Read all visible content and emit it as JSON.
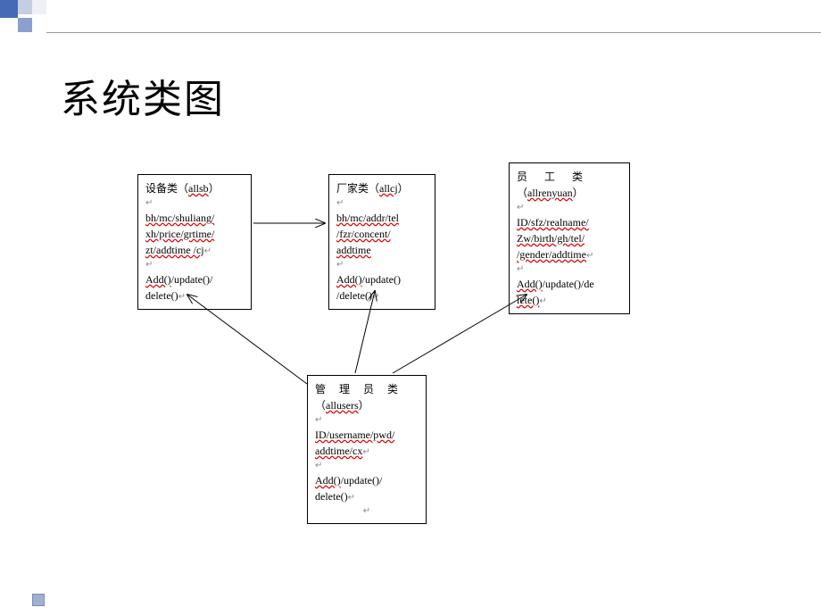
{
  "title": "系统类图",
  "classes": {
    "device": {
      "name": "设备类（",
      "nameClass": "allsb",
      "nameEnd": "）",
      "attrs1": "bh/mc/shuliang/",
      "attrs2": "xh/price/grtime/",
      "attrs3": "zt/addtime /cj",
      "method1": "Add()",
      "method2": "/update()/",
      "method3": "delete()"
    },
    "factory": {
      "name": "厂家类（",
      "nameClass": "allcj",
      "nameEnd": "）",
      "attrs1": "bh/mc/addr/tel",
      "attrs2": "/fzr/concent/",
      "attrs3": "addtime",
      "method1": "Add()",
      "method2": "/update()",
      "method3": "/delete()"
    },
    "employee": {
      "name": "员 工 类",
      "nameClassPre": "（",
      "nameClass": "allrenyuan",
      "nameEnd": "）",
      "attrs1": "ID/sfz/realname/",
      "attrs2": "Zw/birth/gh/tel/",
      "attrs3": "/gender/addtime",
      "method1": "Add()",
      "method2": "/update()/de",
      "method3": "lete()"
    },
    "admin": {
      "name": "管 理 员 类",
      "nameClassPre": "（",
      "nameClass": "allusers",
      "nameEnd": "）",
      "attrs1": "ID/username/pwd/",
      "attrs2": "addtime/cx",
      "method1": "Add()",
      "method2": "/update()/",
      "method3": "delete()"
    }
  }
}
